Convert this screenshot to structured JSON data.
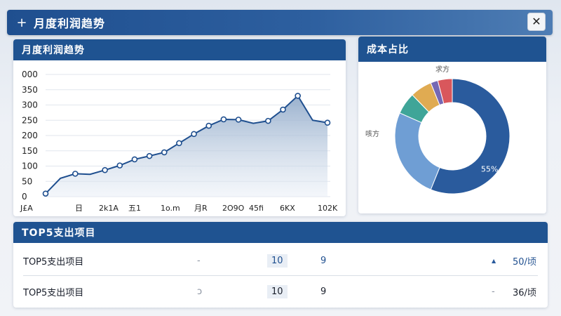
{
  "header": {
    "plus_icon": "+",
    "title": "月度利润趋势",
    "close_icon": "✕"
  },
  "trend_panel": {
    "title": "月度利润趋势"
  },
  "share_panel": {
    "title": "成本占比"
  },
  "top5_panel": {
    "title": "TOP5支出项目",
    "rows": [
      {
        "name": "TOP5支出项目",
        "mark": "-",
        "c1": "10",
        "c2": "9",
        "trend_icon": "▲",
        "value": "50/顷"
      },
      {
        "name": "TOP5支出项目",
        "mark": "ɔ",
        "c1": "10",
        "c2": "9",
        "trend_icon": "-",
        "value": "36/顷"
      }
    ]
  },
  "chart_data": [
    {
      "type": "area",
      "title": "月度利润趋势",
      "y_ticks": [
        "000",
        "350",
        "300",
        "250",
        "200",
        "150",
        "100",
        "50",
        "0"
      ],
      "ylim": [
        0,
        400
      ],
      "x_tick_labels": [
        "J£A",
        "日",
        "2k1A",
        "五1",
        "1o.m",
        "月R",
        "2O9O",
        "45fi",
        "6KX",
        "102K"
      ],
      "series": [
        {
          "values": [
            10,
            60,
            75,
            73,
            87,
            102,
            122,
            133,
            145,
            175,
            205,
            232,
            253,
            252,
            240,
            248,
            285,
            330,
            250,
            242
          ]
        }
      ],
      "colors": {
        "line": "#1f4f8f",
        "fill_top": "#8ea8c8",
        "fill_bottom": "#e8eef6"
      },
      "grid": true
    },
    {
      "type": "pie",
      "title": "成本占比",
      "labels": [
        "",
        "",
        "",
        "",
        "",
        ""
      ],
      "outside_labels": [
        "求方",
        "咳方"
      ],
      "center_hole": true,
      "slices": [
        {
          "value": 55,
          "label": "55%",
          "color": "#2a5b9d"
        },
        {
          "value": 25,
          "label": "",
          "color": "#6f9ed4"
        },
        {
          "value": 6,
          "label": "",
          "color": "#3fa598"
        },
        {
          "value": 6,
          "label": "",
          "color": "#e0ab52"
        },
        {
          "value": 2,
          "label": "",
          "color": "#7568b4"
        },
        {
          "value": 4,
          "label": "",
          "color": "#d9575c"
        }
      ]
    }
  ]
}
